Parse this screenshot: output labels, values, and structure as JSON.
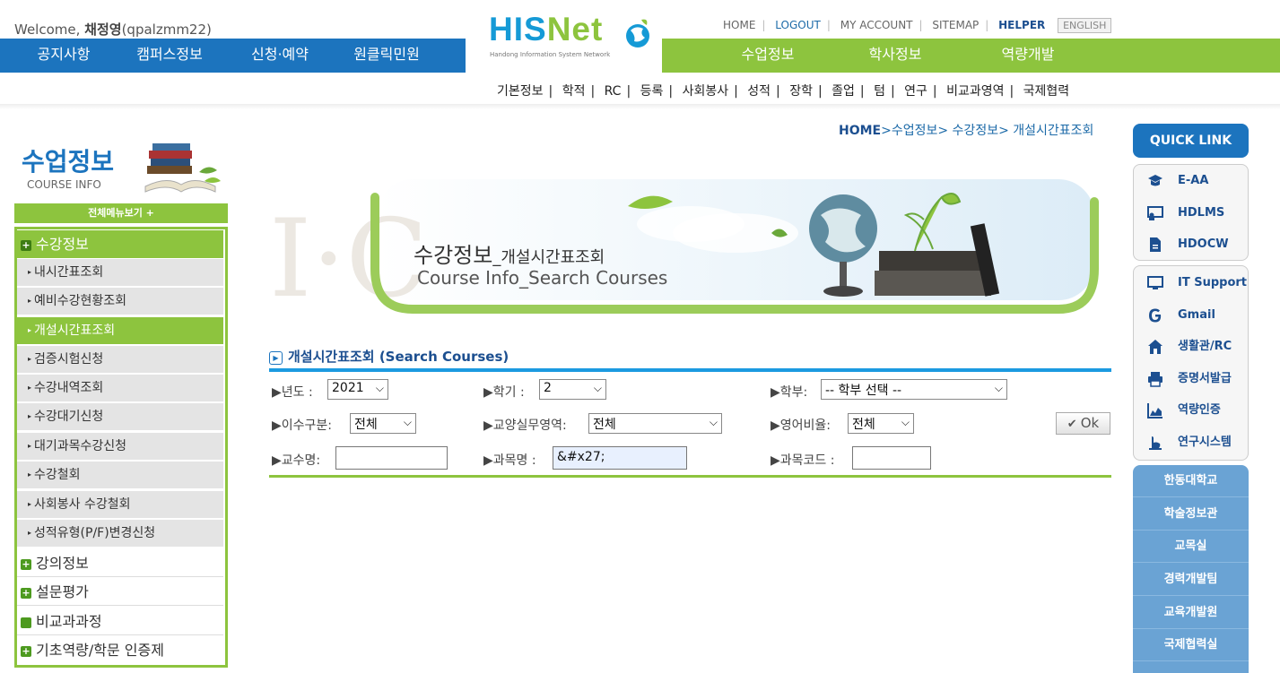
{
  "header": {
    "welcome_prefix": "Welcome,",
    "user_name": "채정영",
    "user_id": "(qpalzmm22)",
    "logo": {
      "text_hi": "HIS",
      "text_net": "Net",
      "subtitle": "Handong Information System Network"
    },
    "util_links": [
      "HOME",
      "LOGOUT",
      "MY ACCOUNT",
      "SITEMAP",
      "HELPER"
    ],
    "english_label": "ENGLISH",
    "left_menu": [
      "공지사항",
      "캠퍼스정보",
      "신청·예약",
      "원클릭민원"
    ],
    "right_menu": [
      "수업정보",
      "학사정보",
      "역량개발"
    ],
    "sub_menu": [
      "기본정보",
      "학적",
      "RC",
      "등록",
      "사회봉사",
      "성적",
      "장학",
      "졸업",
      "텀",
      "연구",
      "비교과영역",
      "국제협력"
    ]
  },
  "sidebar": {
    "title": "수업정보",
    "subtitle": "COURSE INFO",
    "all_menu": "전체메뉴보기 +",
    "groups": [
      {
        "label": "수강정보",
        "expanded": true
      },
      {
        "label": "강의정보"
      },
      {
        "label": "설문평가"
      },
      {
        "label": "비교과과정"
      },
      {
        "label": "기초역량/학문 인증제"
      }
    ],
    "sub_items": [
      "내시간표조회",
      "예비수강현황조회",
      "개설시간표조회",
      "검증시험신청",
      "수강내역조회",
      "수강대기신청",
      "대기과목수강신청",
      "수강철회",
      "사회봉사 수강철회",
      "성적유형(P/F)변경신청"
    ],
    "active_sub": "개설시간표조회"
  },
  "breadcrumb": {
    "home": "HOME",
    "path": ">수업정보> 수강정보> 개설시간표조회"
  },
  "banner": {
    "title_main": "수강정보",
    "title_sub": "_개설시간표조회",
    "subtitle": "Course Info_Search Courses"
  },
  "search": {
    "section_title": "개설시간표조회 (Search Courses)",
    "year": {
      "label": "▶년도 :",
      "value": "2021"
    },
    "term": {
      "label": "▶학기 :",
      "value": "2"
    },
    "dept": {
      "label": "▶학부:",
      "value": "-- 학부 선택 --"
    },
    "category": {
      "label": "▶이수구분:",
      "value": "전체"
    },
    "liberal": {
      "label": "▶교양실무영역:",
      "value": "전체"
    },
    "english_ratio": {
      "label": "▶영어비율:",
      "value": "전체"
    },
    "professor": {
      "label": "▶교수명:",
      "value": ""
    },
    "course_name": {
      "label": "▶과목명 :",
      "value": "&#x27;"
    },
    "course_code": {
      "label": "▶과목코드 :",
      "value": ""
    },
    "ok_label": "Ok"
  },
  "quick_link": {
    "title": "QUICK LINK",
    "group1": [
      "E-AA",
      "HDLMS",
      "HDOCW"
    ],
    "group2": [
      "IT Support",
      "Gmail",
      "생활관/RC",
      "증명서발급",
      "역량인증",
      "연구시스템"
    ],
    "university": [
      "한동대학교",
      "학술정보관",
      "교목실",
      "경력개발팀",
      "교육개발원",
      "국제협력실"
    ]
  },
  "colors": {
    "blue": "#1c74be",
    "green": "#8dc43e",
    "light_blue": "#6aa3d4"
  }
}
